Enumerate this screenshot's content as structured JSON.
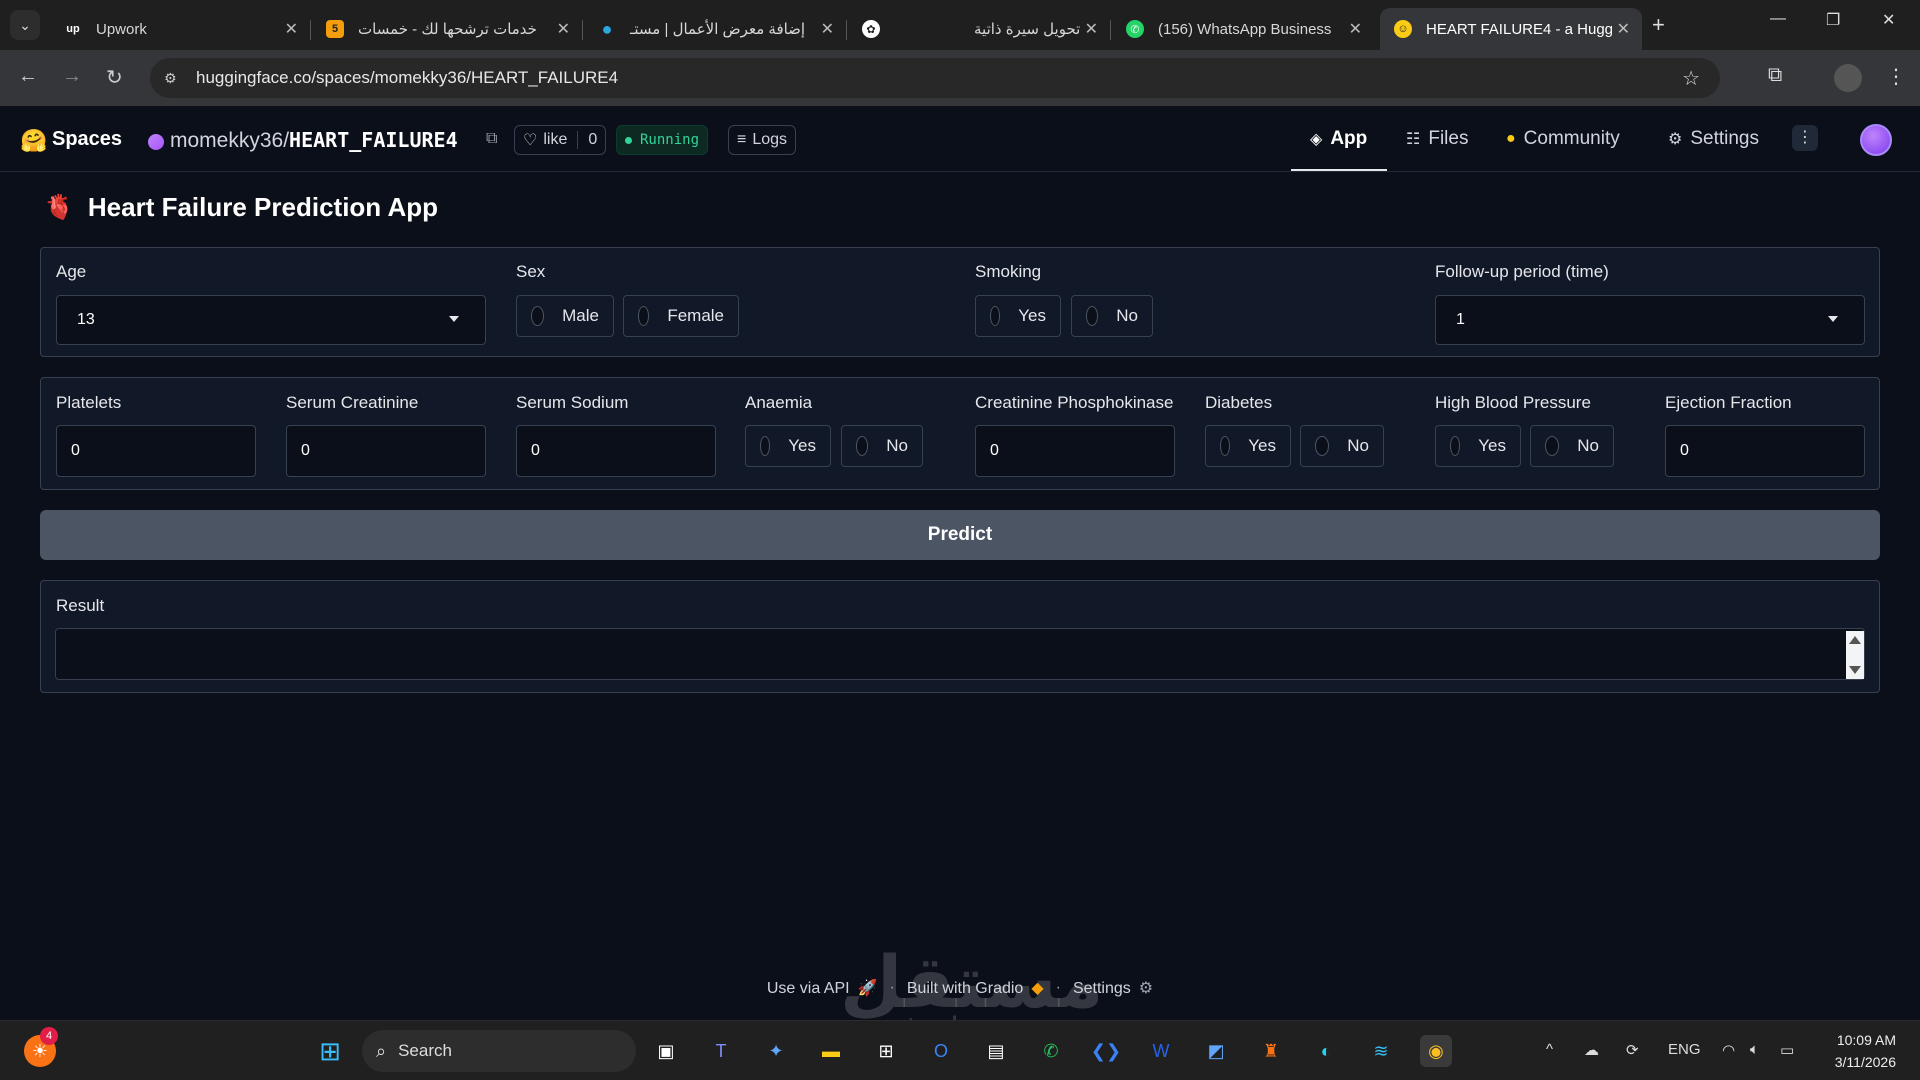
{
  "browser": {
    "tabs": [
      {
        "title": "Upwork",
        "favicon": "upwork-icon"
      },
      {
        "title": "خدمات ترشحها لك - خمسات",
        "favicon": "khamsat-icon"
      },
      {
        "title": "إضافة معرض الأعمال | مستـ",
        "favicon": "mostaql-icon"
      },
      {
        "title": "تحويل سيرة ذاتية",
        "favicon": "chatgpt-icon"
      },
      {
        "title": "(156) WhatsApp Business",
        "favicon": "whatsapp-icon"
      },
      {
        "title": "HEART FAILURE4 - a Hugg",
        "favicon": "huggingface-icon"
      }
    ],
    "url_host": "huggingface.co",
    "url_path": "/spaces/momekky36/HEART_FAILURE4"
  },
  "hf_header": {
    "spaces_label": "Spaces",
    "owner": "momekky36",
    "separator": "/",
    "repo": "HEART_FAILURE4",
    "like_label": "like",
    "like_count": "0",
    "status": "Running",
    "logs_label": "Logs",
    "nav": [
      {
        "label": "App",
        "icon": "cube-icon"
      },
      {
        "label": "Files",
        "icon": "files-icon"
      },
      {
        "label": "Community",
        "icon": "community-icon"
      },
      {
        "label": "Settings",
        "icon": "gear-icon"
      }
    ]
  },
  "app": {
    "title": "Heart Failure Prediction App",
    "row1": {
      "age": {
        "label": "Age",
        "value": "13"
      },
      "sex": {
        "label": "Sex",
        "options": [
          "Male",
          "Female"
        ]
      },
      "smoking": {
        "label": "Smoking",
        "options": [
          "Yes",
          "No"
        ]
      },
      "followup": {
        "label": "Follow-up period (time)",
        "value": "1"
      }
    },
    "row2": {
      "platelets": {
        "label": "Platelets",
        "value": "0"
      },
      "serum_creatinine": {
        "label": "Serum Creatinine",
        "value": "0"
      },
      "serum_sodium": {
        "label": "Serum Sodium",
        "value": "0"
      },
      "anaemia": {
        "label": "Anaemia",
        "options": [
          "Yes",
          "No"
        ]
      },
      "cpk": {
        "label": "Creatinine Phosphokinase",
        "value": "0"
      },
      "diabetes": {
        "label": "Diabetes",
        "options": [
          "Yes",
          "No"
        ]
      },
      "hbp": {
        "label": "High Blood Pressure",
        "options": [
          "Yes",
          "No"
        ]
      },
      "ejection": {
        "label": "Ejection Fraction",
        "value": "0"
      }
    },
    "predict_label": "Predict",
    "result_label": "Result",
    "result_value": ""
  },
  "footer": {
    "api": "Use via API",
    "built": "Built with Gradio",
    "settings": "Settings",
    "separator": "·"
  },
  "watermark": {
    "arabic": "مستقل",
    "latin": "mostaql.com"
  },
  "taskbar": {
    "search_placeholder": "Search",
    "badge_count": "4",
    "lang": "ENG",
    "time": "10:09 AM",
    "date": "3/11/2026"
  }
}
